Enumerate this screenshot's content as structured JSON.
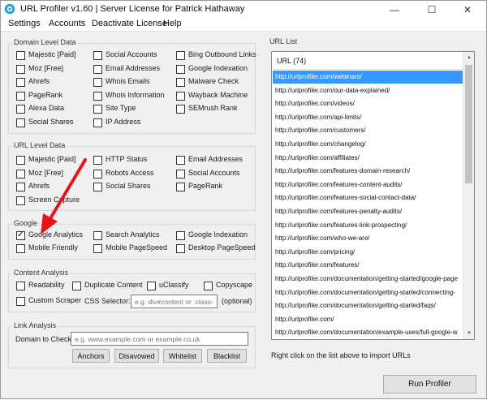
{
  "title": "URL Profiler v1.60 | Server License for Patrick Hathaway",
  "window_controls": {
    "minimize": "—",
    "maximize": "☐",
    "close": "✕"
  },
  "menu": [
    "Settings",
    "Accounts",
    "Deactivate License",
    "Help"
  ],
  "domain_level": {
    "title": "Domain Level Data",
    "items": [
      {
        "label": "Majestic [Paid]",
        "checked": false
      },
      {
        "label": "Social Accounts",
        "checked": false
      },
      {
        "label": "Bing Outbound Links",
        "checked": false
      },
      {
        "label": "Moz [Free]",
        "checked": false
      },
      {
        "label": "Email Addresses",
        "checked": false
      },
      {
        "label": "Google Indexation",
        "checked": false
      },
      {
        "label": "Ahrefs",
        "checked": false
      },
      {
        "label": "Whois Emails",
        "checked": false
      },
      {
        "label": "Malware Check",
        "checked": false
      },
      {
        "label": "PageRank",
        "checked": false
      },
      {
        "label": "Whois Information",
        "checked": false
      },
      {
        "label": "Wayback Machine",
        "checked": false
      },
      {
        "label": "Alexa Data",
        "checked": false
      },
      {
        "label": "Site Type",
        "checked": false
      },
      {
        "label": "SEMrush Rank",
        "checked": false
      },
      {
        "label": "Social Shares",
        "checked": false
      },
      {
        "label": "IP Address",
        "checked": false
      }
    ]
  },
  "url_level": {
    "title": "URL Level Data",
    "items": [
      {
        "label": "Majestic [Paid]",
        "checked": false
      },
      {
        "label": "HTTP Status",
        "checked": false
      },
      {
        "label": "Email Addresses",
        "checked": false
      },
      {
        "label": "Moz [Free]",
        "checked": false
      },
      {
        "label": "Robots Access",
        "checked": false
      },
      {
        "label": "Social Accounts",
        "checked": false
      },
      {
        "label": "Ahrefs",
        "checked": false
      },
      {
        "label": "Social Shares",
        "checked": false
      },
      {
        "label": "PageRank",
        "checked": false
      },
      {
        "label": "Screen Capture",
        "checked": false
      }
    ]
  },
  "google": {
    "title": "Google",
    "items": [
      {
        "label": "Google Analytics",
        "checked": true
      },
      {
        "label": "Search Analytics",
        "checked": false
      },
      {
        "label": "Google Indexation",
        "checked": false
      },
      {
        "label": "Mobile Friendly",
        "checked": false
      },
      {
        "label": "Mobile PageSpeed",
        "checked": false
      },
      {
        "label": "Desktop PageSpeed",
        "checked": false
      }
    ]
  },
  "content": {
    "title": "Content Analysis",
    "items": [
      {
        "label": "Readability",
        "checked": false
      },
      {
        "label": "Duplicate Content",
        "checked": false
      },
      {
        "label": "uClassify",
        "checked": false
      },
      {
        "label": "Copyscape",
        "checked": false
      },
      {
        "label": "Custom Scraper",
        "checked": false
      }
    ],
    "css_label": "CSS Selector:",
    "css_placeholder": "e.g. div#content or .class-na",
    "optional": "(optional)"
  },
  "link": {
    "title": "Link Analysis",
    "domain_label": "Domain to Check:",
    "domain_placeholder": "e.g. www.example.com or example.co.uk",
    "buttons": [
      "Anchors",
      "Disavowed",
      "Whitelist",
      "Blacklist"
    ]
  },
  "url_list": {
    "title": "URL List",
    "header": "URL (74)",
    "urls": [
      "http://urlprofiler.com/webinars/",
      "http://urlprofiler.com/our-data-explained/",
      "http://urlprofiler.com/videos/",
      "http://urlprofiler.com/api-limits/",
      "http://urlprofiler.com/customers/",
      "http://urlprofiler.com/changelog/",
      "http://urlprofiler.com/affiliates/",
      "http://urlprofiler.com/features-domain-research/",
      "http://urlprofiler.com/features-content-audits/",
      "http://urlprofiler.com/features-social-contact-data/",
      "http://urlprofiler.com/features-penalty-audits/",
      "http://urlprofiler.com/features-link-prospecting/",
      "http://urlprofiler.com/who-we-are/",
      "http://urlprofiler.com/pricing/",
      "http://urlprofiler.com/features/",
      "http://urlprofiler.com/documentation/getting-started/google-page",
      "http://urlprofiler.com/documentation/getting-started/connecting-",
      "http://urlprofiler.com/documentation/getting-started/faqs/",
      "http://urlprofiler.com/",
      "http://urlprofiler.com/documentation/example-uses/full-google-w"
    ],
    "selected_index": 0,
    "hint": "Right click on the list above to import URLs"
  },
  "run_button": "Run Profiler",
  "colors": {
    "selection": "#3399ff",
    "annotation_arrow": "#e8141c"
  }
}
